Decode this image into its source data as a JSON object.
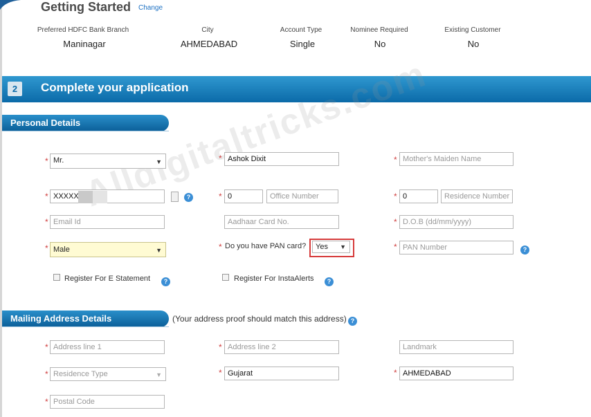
{
  "header": {
    "title": "Getting Started",
    "change_link": "Change"
  },
  "summary": [
    {
      "label": "Preferred HDFC Bank Branch",
      "value": "Maninagar"
    },
    {
      "label": "City",
      "value": "AHMEDABAD"
    },
    {
      "label": "Account Type",
      "value": "Single"
    },
    {
      "label": "Nominee Required",
      "value": "No"
    },
    {
      "label": "Existing Customer",
      "value": "No"
    }
  ],
  "step": {
    "number": "2",
    "title": "Complete your application"
  },
  "personal": {
    "section_title": "Personal Details",
    "salutation": "Mr.",
    "name": "Ashok Dixit",
    "maiden_placeholder": "Mother's Maiden Name",
    "mobile": "XXXXX",
    "office_code": "0",
    "office_placeholder": "Office Number",
    "res_code": "0",
    "res_placeholder": "Residence Number",
    "email_placeholder": "Email Id",
    "aadhaar_placeholder": "Aadhaar Card No.",
    "dob_placeholder": "D.O.B (dd/mm/yyyy)",
    "gender": "Male",
    "pan_question": "Do you have PAN card?",
    "pan_answer": "Yes",
    "pan_placeholder": "PAN Number",
    "estatement_label": "Register For E Statement",
    "instaalerts_label": "Register For InstaAlerts"
  },
  "mailing": {
    "section_title": "Mailing Address Details",
    "note": "(Your address proof should match this address)",
    "line1_placeholder": "Address line 1",
    "line2_placeholder": "Address line 2",
    "landmark_placeholder": "Landmark",
    "residence_type": "Residence Type",
    "state": "Gujarat",
    "city": "AHMEDABAD",
    "postal_placeholder": "Postal Code"
  },
  "watermark": "Alldigitaltricks.com",
  "icons": {
    "help": "help-question-icon",
    "caret": "caret-down-icon"
  },
  "colors": {
    "accent": "#0b6aa8",
    "required": "#d04040",
    "highlight": "#d63a3a"
  }
}
